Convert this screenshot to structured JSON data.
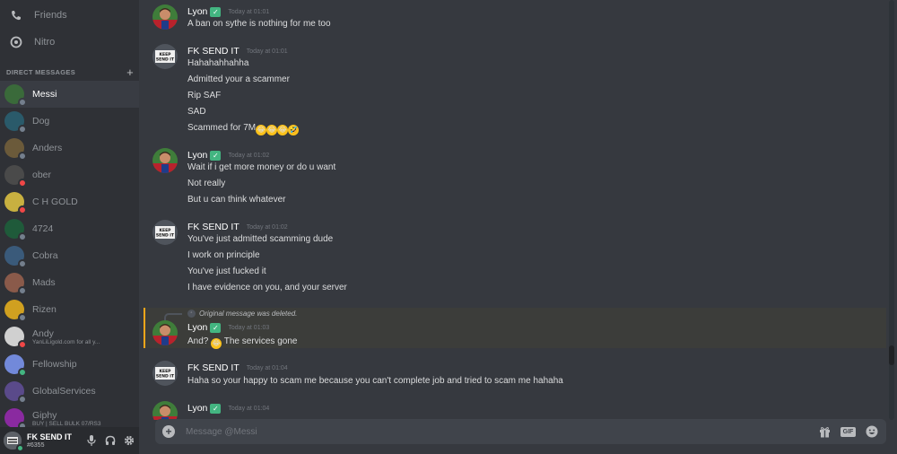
{
  "sidebar": {
    "nav": [
      {
        "label": "Friends",
        "icon": "friends-icon"
      },
      {
        "label": "Nitro",
        "icon": "nitro-icon"
      }
    ],
    "dm_header": "DIRECT MESSAGES",
    "dms": [
      {
        "name": "Messi",
        "status": "offline",
        "avatar_color": "#3a6a3a",
        "active": true
      },
      {
        "name": "Dog",
        "status": "offline",
        "avatar_color": "#2a5a6a"
      },
      {
        "name": "Anders",
        "status": "offline",
        "avatar_color": "#6b5a3a"
      },
      {
        "name": "ober",
        "status": "dnd",
        "avatar_color": "#4a4a4a"
      },
      {
        "name": "C H GOLD",
        "status": "dnd",
        "avatar_color": "#c8b040"
      },
      {
        "name": "4724",
        "status": "offline",
        "avatar_color": "#1f5a3a"
      },
      {
        "name": "Cobra",
        "status": "offline",
        "avatar_color": "#3a5a7a"
      },
      {
        "name": "Mads",
        "status": "offline",
        "avatar_color": "#8a5a4a"
      },
      {
        "name": "Rizen",
        "status": "offline",
        "avatar_color": "#d0a020"
      },
      {
        "name": "Andy",
        "sub": "YanLiLigold.com for all y...",
        "status": "dnd",
        "avatar_color": "#d0d0d0"
      },
      {
        "name": "Fellowship",
        "status": "online",
        "avatar_color": "#7289da"
      },
      {
        "name": "GlobalServices",
        "status": "offline",
        "avatar_color": "#5a4a8a"
      },
      {
        "name": "Giphy",
        "sub": "BUY | SELL BULK 07/RS3",
        "status": "offline",
        "avatar_color": "#8a2aa0"
      }
    ]
  },
  "user_panel": {
    "name": "FK SEND IT",
    "tag": "#6355"
  },
  "chat": {
    "groups": [
      {
        "author": "Lyon",
        "verified": true,
        "timestamp": "Today at 01:01",
        "avatar": "lyon",
        "lines": [
          {
            "text": "A ban on sythe is nothing for me too"
          }
        ]
      },
      {
        "author": "FK SEND IT",
        "verified": false,
        "timestamp": "Today at 01:01",
        "avatar": "fk",
        "lines": [
          {
            "text": "Hahahahhahha"
          },
          {
            "text": "Admitted your a scammer"
          },
          {
            "text": "Rip SAF"
          },
          {
            "text": "SAD"
          },
          {
            "text": "Scammed for 7M",
            "emojis": [
              "😂",
              "😂",
              "😂",
              "🤣"
            ]
          }
        ]
      },
      {
        "author": "Lyon",
        "verified": true,
        "timestamp": "Today at 01:02",
        "avatar": "lyon",
        "lines": [
          {
            "text": "Wait if i get more money or do u want"
          },
          {
            "text": "Not really"
          },
          {
            "text": "But u can think whatever"
          }
        ]
      },
      {
        "author": "FK SEND IT",
        "verified": false,
        "timestamp": "Today at 01:02",
        "avatar": "fk",
        "lines": [
          {
            "text": "You've just admitted scamming dude"
          },
          {
            "text": "I work on principle"
          },
          {
            "text": "You've just fucked it"
          },
          {
            "text": "I have evidence on you, and your server"
          }
        ]
      },
      {
        "author": "Lyon",
        "verified": true,
        "timestamp": "Today at 01:03",
        "avatar": "lyon",
        "reply": "Original message was deleted.",
        "lines": [
          {
            "text_before": "And?",
            "emoji": "😂",
            "text_after": "The services gone"
          }
        ]
      },
      {
        "author": "FK SEND IT",
        "verified": false,
        "timestamp": "Today at 01:04",
        "avatar": "fk",
        "lines": [
          {
            "text": "Haha so your happy to scam me because you can't  complete job and tried to scam me hahaha"
          }
        ]
      },
      {
        "author": "Lyon",
        "verified": true,
        "timestamp": "Today at 01:04",
        "avatar": "lyon",
        "lines": []
      }
    ]
  },
  "input": {
    "placeholder": "Message @Messi"
  },
  "colors": {
    "background": "#36393f",
    "sidebar": "#2f3136",
    "online": "#43b581",
    "dnd": "#f04747",
    "offline": "#747f8d",
    "mention_highlight": "#faa61a"
  }
}
